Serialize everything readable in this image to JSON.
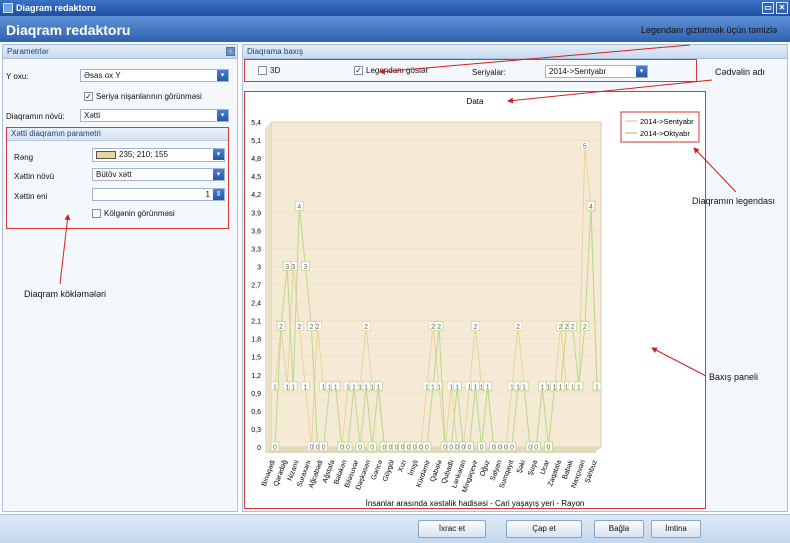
{
  "window": {
    "title": "Diagram redaktoru"
  },
  "header": {
    "title": "Diaqram redaktoru"
  },
  "left_panel": {
    "section_title": "Parametrlər",
    "y_axis_label": "Y oxu:",
    "y_axis_value": "Əsas ox Y",
    "series_markers_label": "Seriya nişanlarının görünməsi",
    "series_markers_checked": true,
    "chart_type_label": "Diaqramın növü:",
    "chart_type_value": "Xətti",
    "line_params_title": "Xətti diaqramın parametri",
    "color_label": "Rəng",
    "color_value": "235; 210; 155",
    "color_hex": "#ebd29b",
    "line_type_label": "Xəttin növü",
    "line_type_value": "Bütöv xətt",
    "line_width_label": "Xəttin eni",
    "line_width_value": "1",
    "shadow_label": "Kölgənin görünməsi",
    "shadow_checked": false
  },
  "right_panel": {
    "section_title": "Diaqrama baxış",
    "check_3d_label": "3D",
    "check_3d_checked": false,
    "legend_label": "Legendanı göstər",
    "legend_checked": true,
    "series_label": "Seriyalar:",
    "series_value": "2014->Sentyabr"
  },
  "chart_data": {
    "type": "line",
    "title": "Data",
    "xlabel": "İnsanlar arasında xəstəlik hadisəsi - Cari yaşayış yeri - Rayon",
    "ylabel": "",
    "ylim": [
      0,
      5.4
    ],
    "yticks": [
      "0",
      "0,3",
      "0,6",
      "0,9",
      "1,2",
      "1,5",
      "1,8",
      "2,1",
      "2,4",
      "2,7",
      "3",
      "3,3",
      "3,6",
      "3,9",
      "4,2",
      "4,5",
      "4,8",
      "5,1",
      "5,4"
    ],
    "categories": [
      "Binəqədi",
      "Qaradağ",
      "Nizami",
      "Suraxanı",
      "Ağcabədi",
      "Ağstafa",
      "Balakən",
      "Biləsuvar",
      "Daşkəsən",
      "Gəncə",
      "Göygöl",
      "Xızı",
      "İmişli",
      "Kürdəmir",
      "Qəbələ",
      "Qubadlı",
      "Lənkəran",
      "Mingəçevir",
      "Oğuz",
      "Salyan",
      "Sumqayıt",
      "Şəki",
      "Şuşa",
      "Ucar",
      "Zaqatala",
      "Babək",
      "Naxçıvan",
      "Şahbuz"
    ],
    "legend_position": "top-right",
    "series": [
      {
        "name": "2014->Sentyabr",
        "color": "#ebd29b",
        "values": [
          1,
          2,
          1,
          3,
          2,
          1,
          0,
          2,
          1,
          1,
          1,
          0,
          1,
          1,
          1,
          2,
          1,
          1,
          0,
          0,
          0,
          0,
          0,
          0,
          0,
          1,
          2,
          1,
          0,
          1,
          0,
          0,
          1,
          2,
          1,
          1,
          0,
          0,
          0,
          1,
          2,
          1,
          0,
          0,
          1,
          1,
          1,
          2,
          1,
          1,
          1,
          5,
          4,
          1
        ]
      },
      {
        "name": "2014->Oktyabr",
        "color": "#b9d98a",
        "values": [
          0,
          2,
          3,
          1,
          4,
          3,
          2,
          0,
          0,
          1,
          1,
          0,
          0,
          1,
          0,
          1,
          0,
          1,
          0,
          0,
          0,
          0,
          0,
          0,
          0,
          0,
          1,
          2,
          0,
          0,
          1,
          0,
          0,
          1,
          0,
          1,
          0,
          0,
          0,
          0,
          1,
          1,
          0,
          0,
          1,
          0,
          1,
          1,
          2,
          2,
          1,
          2,
          4,
          1
        ]
      }
    ]
  },
  "annotations": {
    "legend_hide": "Legendanı gizlətmək üçün təmizlə",
    "table_name": "Cədvəlin adı",
    "chart_legend": "Diaqramın legendası",
    "view_panel": "Baxış paneli",
    "chart_settings": "Diaqram kökləmələri"
  },
  "footer": {
    "export": "İxrac et",
    "print": "Çap et",
    "close": "Bağla",
    "cancel": "İmtina"
  }
}
